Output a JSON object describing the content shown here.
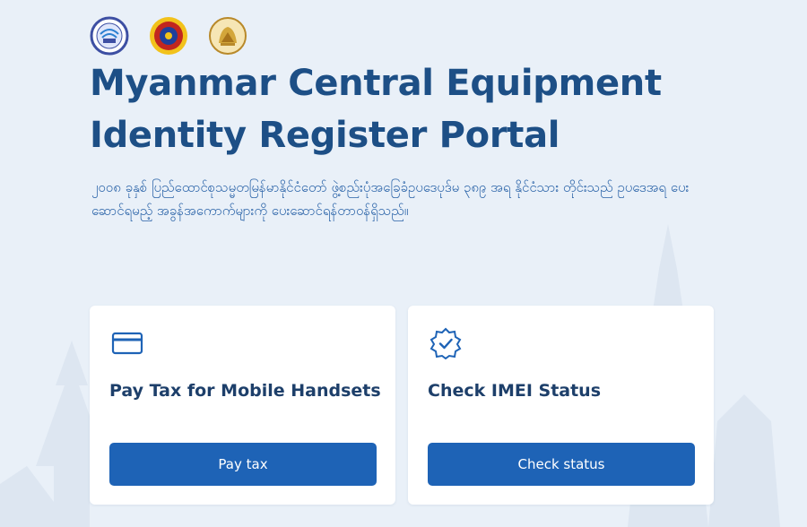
{
  "header": {
    "logos": [
      {
        "icon": "ptd-logo-icon"
      },
      {
        "icon": "ministry-seal-logo-icon"
      },
      {
        "icon": "state-emblem-logo-icon"
      }
    ],
    "title": "Myanmar Central Equipment Identity Register Portal",
    "subtitle": "၂၀၀၈ ခုနှစ် ပြည်ထောင်စုသမ္မတမြန်မာနိုင်ငံတော် ဖွဲ့စည်းပုံအခြေခံဥပဒေပုဒ်မ ၃၈၉ အရ နိုင်ငံသား တိုင်းသည် ဥပဒေအရ ပေးဆောင်ရမည့် အခွန်အကောက်များကို ပေးဆောင်ရန်တာဝန်ရှိသည်။"
  },
  "cards": [
    {
      "icon": "credit-card-icon",
      "title": "Pay Tax for Mobile Handsets",
      "button_label": "Pay tax"
    },
    {
      "icon": "verified-badge-icon",
      "title": "Check IMEI Status",
      "button_label": "Check status"
    }
  ],
  "colors": {
    "background": "#e9f0f8",
    "title": "#1d4f86",
    "subtitle": "#2a63a8",
    "button": "#1e63b6",
    "card_title": "#1d3f6a"
  }
}
